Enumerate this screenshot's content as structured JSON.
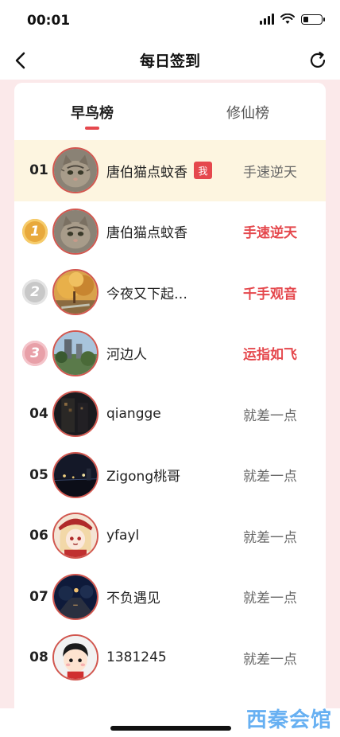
{
  "status_bar": {
    "time": "00:01",
    "battery_level": 0.3
  },
  "nav": {
    "title": "每日签到"
  },
  "tabs": [
    {
      "label": "早鸟榜",
      "active": true
    },
    {
      "label": "修仙榜",
      "active": false
    }
  ],
  "me_row": {
    "rank": "01",
    "name": "唐伯猫点蚊香",
    "badge": "我",
    "status": "手速逆天",
    "avatar": "cat"
  },
  "list": [
    {
      "medal": "1",
      "medal_color": "#e8a93c",
      "name": "唐伯猫点蚊香",
      "status": "手速逆天",
      "hot": true,
      "avatar": "cat"
    },
    {
      "medal": "2",
      "medal_color": "#c8c8c8",
      "name": "今夜又下起…",
      "status": "千手观音",
      "hot": true,
      "avatar": "autumn"
    },
    {
      "medal": "3",
      "medal_color": "#e8a0a8",
      "name": "河边人",
      "status": "运指如飞",
      "hot": true,
      "avatar": "river"
    },
    {
      "rank": "04",
      "name": "qiangge",
      "status": "就差一点",
      "hot": false,
      "avatar": "night-building"
    },
    {
      "rank": "05",
      "name": "Zigong桃哥",
      "status": "就差一点",
      "hot": false,
      "avatar": "night-city"
    },
    {
      "rank": "06",
      "name": "yfayl",
      "status": "就差一点",
      "hot": false,
      "avatar": "anime-girl"
    },
    {
      "rank": "07",
      "name": "不负遇见",
      "status": "就差一点",
      "hot": false,
      "avatar": "night-street"
    },
    {
      "rank": "08",
      "name": "1381245",
      "status": "就差一点",
      "hot": false,
      "avatar": "cartoon-boy"
    }
  ],
  "watermark": "西秦会馆",
  "colors": {
    "accent": "#e5484d",
    "me_row_bg": "#fdf5e0",
    "page_bg": "#fbe9ea"
  }
}
